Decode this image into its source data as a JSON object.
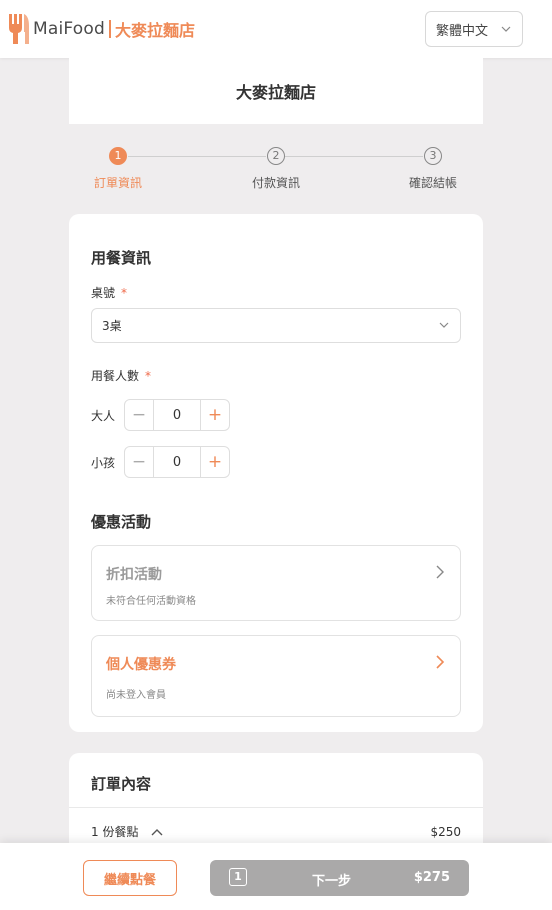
{
  "header": {
    "brand": "MaiFood",
    "store_name": "大麥拉麵店",
    "language": "繁體中文",
    "colors": {
      "accent": "#ef8a57",
      "logo": "#ef8a57"
    }
  },
  "store_banner": {
    "title": "大麥拉麵店"
  },
  "stepper": {
    "steps": [
      {
        "number": "1",
        "label": "訂單資訊",
        "active": true
      },
      {
        "number": "2",
        "label": "付款資訊",
        "active": false
      },
      {
        "number": "3",
        "label": "確認結帳",
        "active": false
      }
    ]
  },
  "dining": {
    "title": "用餐資訊",
    "table_label": "桌號",
    "required_mark": "*",
    "table_value": "3桌",
    "guests_label": "用餐人數",
    "adults_label": "大人",
    "adults_count": "0",
    "children_label": "小孩",
    "children_count": "0",
    "minus": "−",
    "plus": "+"
  },
  "promotions": {
    "title": "優惠活動",
    "discount": {
      "title": "折扣活動",
      "subtitle": "未符合任何活動資格",
      "icon": "chevron-right-icon"
    },
    "coupon": {
      "title": "個人優惠券",
      "subtitle": "尚未登入會員",
      "icon": "chevron-right-icon"
    }
  },
  "order": {
    "title": "訂單內容",
    "items_summary": "1 份餐點",
    "items_total": "$250"
  },
  "bottom_bar": {
    "continue_label": "繼續點餐",
    "cart_count": "1",
    "next_label": "下一步",
    "next_total": "$275"
  }
}
